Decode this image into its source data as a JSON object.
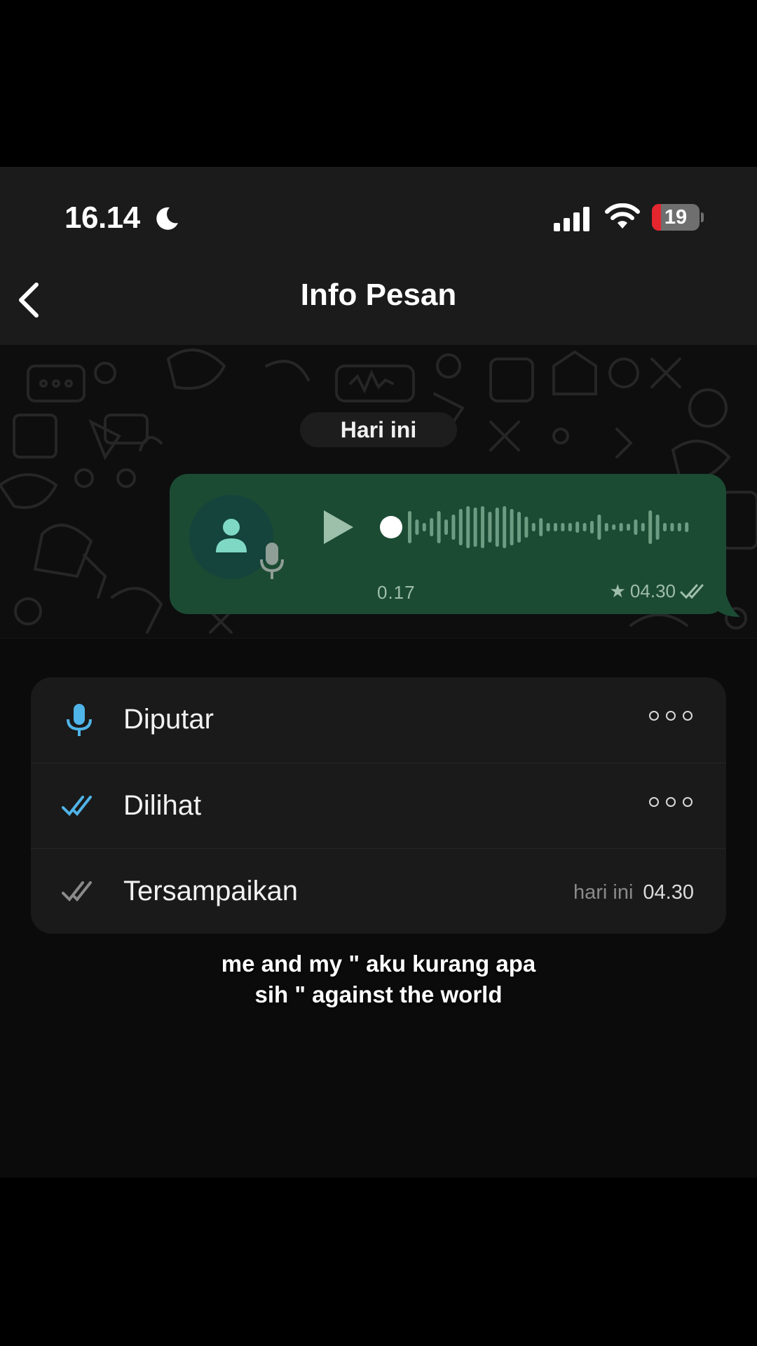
{
  "status_bar": {
    "time": "16.14",
    "battery_percent": "19",
    "battery_level": 0.19,
    "icons": [
      "moon-icon",
      "signal-bars-icon",
      "wifi-icon",
      "battery-icon"
    ]
  },
  "nav": {
    "back_icon": "chevron-left-icon",
    "title": "Info Pesan"
  },
  "chat": {
    "date_chip": "Hari ini",
    "voice_message": {
      "duration": "0.17",
      "time": "04.30",
      "starred": true,
      "read_icon": "double-check-icon",
      "icons": [
        "avatar-person-icon",
        "mic-icon",
        "play-icon"
      ],
      "bubble_color": "#1c4b34"
    }
  },
  "info_rows": [
    {
      "label": "Diputar",
      "icon": "mic-icon",
      "icon_color": "#4fb4e8",
      "value": "○○○"
    },
    {
      "label": "Dilihat",
      "icon": "double-check-icon",
      "icon_color": "#4fb4e8",
      "value": "○○○"
    },
    {
      "label": "Tersampaikan",
      "icon": "double-check-icon",
      "icon_color": "#8a8a8a",
      "value_day": "hari ini",
      "value_time": "04.30"
    }
  ],
  "caption": {
    "line1": "me and my \" aku kurang apa",
    "line2": "sih \" against the world"
  }
}
